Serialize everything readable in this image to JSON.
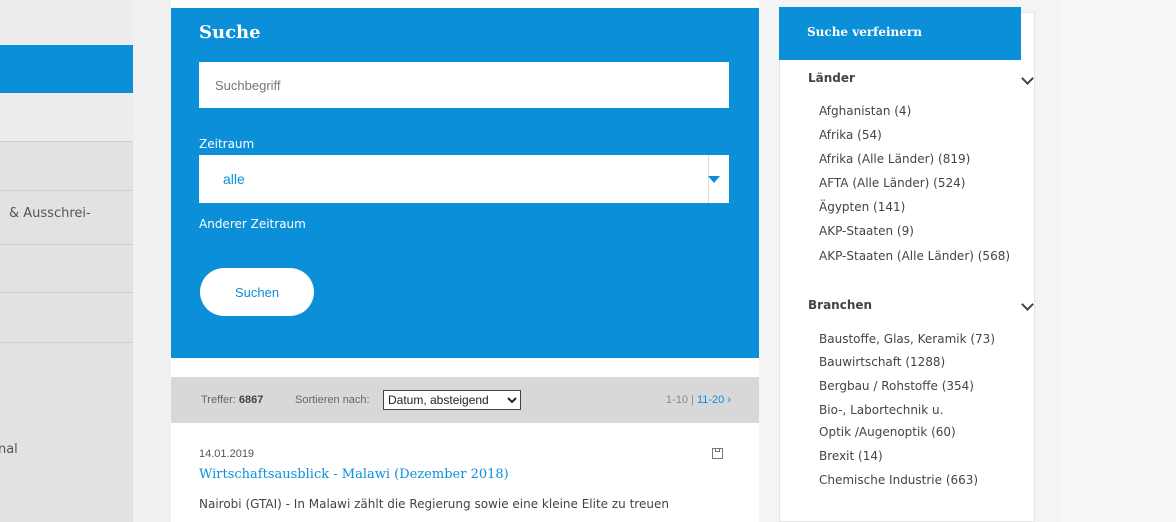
{
  "left_nav": {
    "item_1": "& Ausschrei-",
    "item_2": "onal"
  },
  "search": {
    "title": "Suche",
    "placeholder": "Suchbegriff",
    "zeitraum_label": "Zeitraum",
    "zeitraum_value": "alle",
    "anderer_zeitraum": "Anderer Zeitraum",
    "submit_label": "Suchen"
  },
  "results_bar": {
    "treffer_label": "Treffer:",
    "treffer_count": "6867",
    "sort_label": "Sortieren nach:",
    "sort_value": "Datum, absteigend",
    "page_current": "1-10",
    "page_separator": "|",
    "page_next": "11-20",
    "next_icon": "chevron-right"
  },
  "result": {
    "date": "14.01.2019",
    "title": "Wirtschaftsausblick - Malawi (Dezember 2018)",
    "snippet": "Nairobi (GTAI) - In Malawi zählt die Regierung sowie eine kleine Elite zu treuen"
  },
  "sidebar": {
    "header": "Suche verfeinern",
    "laender": {
      "title": "Länder",
      "items": [
        "Afghanistan (4)",
        "Afrika (54)",
        "Afrika (Alle Länder) (819)",
        "AFTA (Alle Länder) (524)",
        "Ägypten (141)",
        "AKP-Staaten (9)",
        "AKP-Staaten (Alle Länder) (568)"
      ]
    },
    "branchen": {
      "title": "Branchen",
      "items": [
        "Baustoffe, Glas, Keramik (73)",
        "Bauwirtschaft (1288)",
        "Bergbau / Rohstoffe (354)",
        "Bio-, Labortechnik u.",
        "Optik /Augenoptik (60)",
        "Brexit (14)",
        "Chemische Industrie (663)"
      ]
    }
  },
  "colors": {
    "accent": "#0a8fd8",
    "results_bar": "#d8d8d8"
  }
}
